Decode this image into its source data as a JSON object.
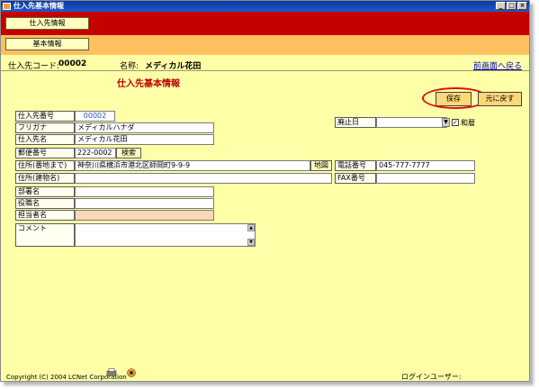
{
  "window": {
    "title": "仕入先基本情報",
    "controls": [
      "_",
      "□",
      "×"
    ]
  },
  "nav": {
    "tab1": "仕入先情報",
    "tab2": "基本情報"
  },
  "header": {
    "code_label": "仕入先コード:",
    "code_value": "00002",
    "name_label": "名称:",
    "name_value": "メディカル花田",
    "back_link": "前画面へ戻る"
  },
  "section_title": "仕入先基本情報",
  "actions": {
    "save": "保存",
    "return": "元に戻す"
  },
  "form": {
    "supplier_no_label": "仕入先番号",
    "supplier_no_value": "00002",
    "furigana_label": "フリガナ",
    "furigana_value": "メディカルハナダ",
    "name_label": "仕入先名",
    "name_value": "メディカル花田",
    "zip_label": "郵便番号",
    "zip_value": "222-0002",
    "search_btn": "検索",
    "address1_label": "住所(番地まで)",
    "address1_value": "神奈川県横浜市港北区師岡町9-9-9",
    "map_btn": "地図",
    "address2_label": "住所(建物名)",
    "address2_value": "",
    "dept_label": "部署名",
    "title_label": "役職名",
    "contact_label": "担当者名",
    "comment_label": "コメント",
    "closed_date_label": "廃止日",
    "wareki_label": "和暦",
    "wareki_checked": true,
    "phone_label": "電話番号",
    "phone_value": "045-777-7777",
    "fax_label": "FAX番号",
    "fax_value": ""
  },
  "footer": {
    "copyright": "Copyright (C) 2004 LCNet Corporation",
    "login_label": "ログインユーザー:"
  }
}
